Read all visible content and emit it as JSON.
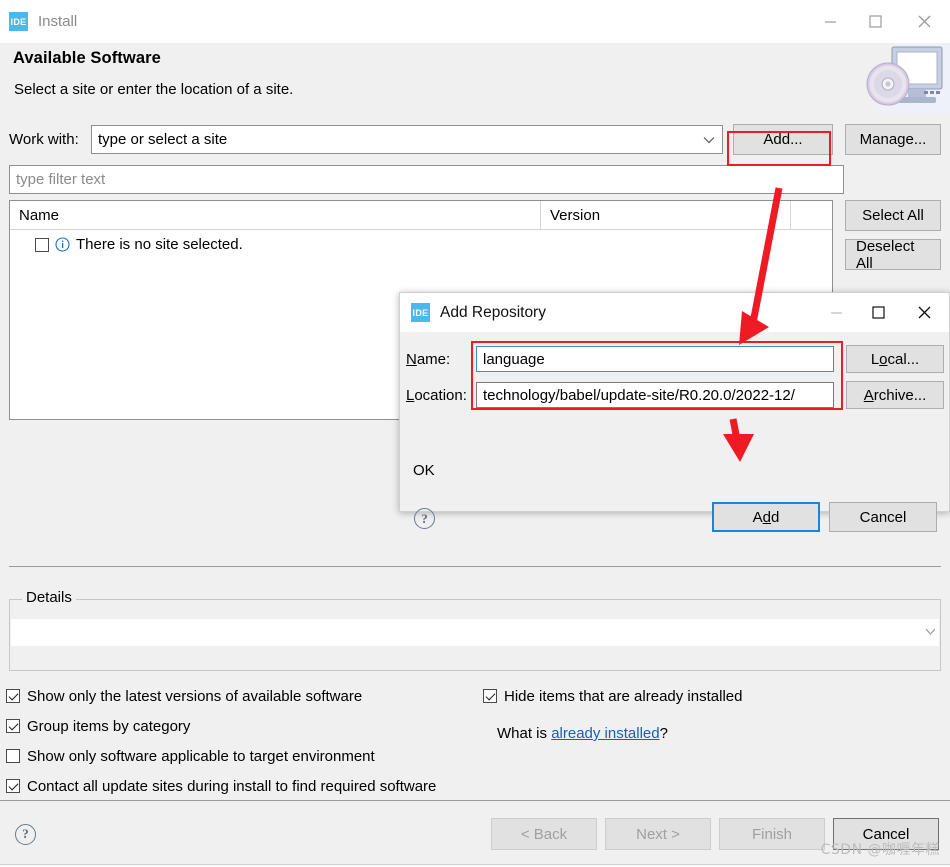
{
  "window": {
    "app_icon_text": "IDE",
    "title": "Install",
    "controls": {
      "minimize": "minimize-icon",
      "maximize": "maximize-icon",
      "close": "close-icon"
    },
    "header_title": "Available Software",
    "header_subtitle": "Select a site or enter the location of a site.",
    "banner_icon": "computer-disc-icon"
  },
  "work_with": {
    "label": "Work with:",
    "value": "type or select a site",
    "dropdown_icon": "chevron-down-icon",
    "add_button": "Add...",
    "manage_button": "Manage..."
  },
  "filter": {
    "placeholder": "type filter text",
    "value": ""
  },
  "table": {
    "columns": [
      "Name",
      "Version"
    ],
    "rows": [
      {
        "checked": false,
        "icon": "info-icon",
        "name": "There is no site selected.",
        "version": ""
      }
    ]
  },
  "side_buttons": [
    {
      "label": "Select All",
      "name": "select-all-button"
    },
    {
      "label": "Deselect All",
      "name": "deselect-all-button"
    }
  ],
  "details": {
    "legend": "Details",
    "value": "",
    "scroll_icon": "scrollbar-down-icon"
  },
  "options": {
    "left": [
      {
        "label": "Show only the latest versions of available software",
        "checked": true
      },
      {
        "label": "Group items by category",
        "checked": true
      },
      {
        "label": "Show only software applicable to target environment",
        "checked": false
      },
      {
        "label": "Contact all update sites during install to find required software",
        "checked": true
      }
    ],
    "right": [
      {
        "label": "Hide items that are already installed",
        "checked": true
      }
    ],
    "what_is_prefix": "What is ",
    "what_is_link": "already installed",
    "what_is_suffix": "?"
  },
  "footer": {
    "help_icon": "help-icon",
    "buttons": [
      {
        "label": "< Back",
        "enabled": false
      },
      {
        "label": "Next >",
        "enabled": false
      },
      {
        "label": "Finish",
        "enabled": false
      },
      {
        "label": "Cancel",
        "enabled": true
      }
    ]
  },
  "watermark": "CSDN @咖喱年糕",
  "dialog": {
    "app_icon_text": "IDE",
    "title": "Add Repository",
    "controls": {
      "minimize": "minimize-icon",
      "maximize": "maximize-icon",
      "close": "close-icon"
    },
    "name_label_mnemonic": "N",
    "name_label_rest": "ame:",
    "name_value": "language",
    "location_label_mnemonic": "L",
    "location_label_rest": "ocation:",
    "location_value": "technology/babel/update-site/R0.20.0/2022-12/",
    "local_button_mnemonic": "o",
    "local_button_pre": "L",
    "local_button_post": "cal...",
    "archive_button_mnemonic": "A",
    "archive_button_rest": "rchive...",
    "status": "OK",
    "help_icon": "help-icon",
    "add_button_pre": "A",
    "add_button_mnemonic": "d",
    "add_button_post": "d",
    "cancel_button": "Cancel"
  },
  "annotations": {
    "highlight_color": "#ee1b24",
    "rect_add_button": "red-rectangle-add-button",
    "rect_fields": "red-rectangle-name-location",
    "arrow_to_dialog": "red-arrow-down",
    "arrow_to_add": "red-arrow-down-short"
  }
}
